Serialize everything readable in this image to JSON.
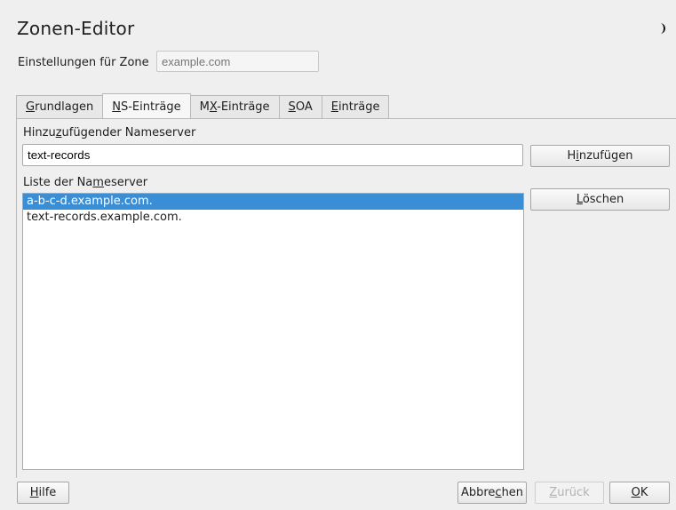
{
  "window": {
    "title": "Zonen-Editor"
  },
  "zone": {
    "label": "Einstellungen für Zone",
    "placeholder": "example.com"
  },
  "tabs": [
    {
      "pre": "",
      "u": "G",
      "post": "rundlagen",
      "active": false
    },
    {
      "pre": "",
      "u": "N",
      "post": "S-Einträge",
      "active": true
    },
    {
      "pre": "M",
      "u": "X",
      "post": "-Einträge",
      "active": false
    },
    {
      "pre": "",
      "u": "S",
      "post": "OA",
      "active": false
    },
    {
      "pre": "",
      "u": "E",
      "post": "inträge",
      "active": false
    }
  ],
  "ns_input": {
    "label_pre": "Hinzu",
    "label_u": "z",
    "label_post": "ufügender Nameserver",
    "value": "text-records"
  },
  "add_button": {
    "pre": "H",
    "u": "i",
    "post": "nzufügen"
  },
  "list": {
    "label_pre": "Liste der Na",
    "label_u": "m",
    "label_post": "eserver",
    "items": [
      "a-b-c-d.example.com.",
      "text-records.example.com."
    ],
    "selected_index": 0
  },
  "delete_button": {
    "pre": "",
    "u": "L",
    "post": "öschen"
  },
  "footer": {
    "help": {
      "pre": "",
      "u": "H",
      "post": "ilfe"
    },
    "abort": {
      "pre": "Abbre",
      "u": "c",
      "post": "hen"
    },
    "back": {
      "pre": "",
      "u": "Z",
      "post": "urück"
    },
    "ok": {
      "pre": "",
      "u": "O",
      "post": "K"
    }
  }
}
